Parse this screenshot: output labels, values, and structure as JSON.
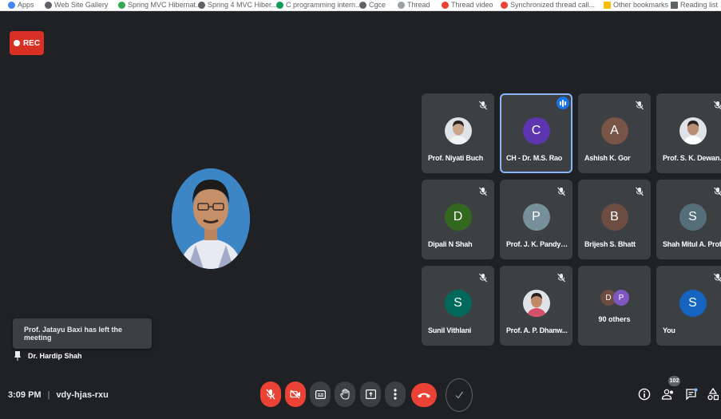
{
  "bookmarks": [
    {
      "label": "Apps",
      "color": "#4285f4"
    },
    {
      "label": "Web Site Gallery",
      "color": "#5f6368"
    },
    {
      "label": "Spring MVC Hibernat...",
      "color": "#34a853"
    },
    {
      "label": "Spring 4 MVC Hiber...",
      "color": "#5f6368"
    },
    {
      "label": "C programming intern...",
      "color": "#0f9d58"
    },
    {
      "label": "Cgce",
      "color": "#5f6368"
    },
    {
      "label": "Thread",
      "color": "#9aa0a6"
    },
    {
      "label": "Thread video",
      "color": "#ea4335"
    },
    {
      "label": "Synchronized thread call...",
      "color": "#ea4335"
    },
    {
      "label": "Other bookmarks",
      "color": "#fbbc04"
    },
    {
      "label": "Reading list",
      "color": "#5f6368"
    }
  ],
  "rec_label": "REC",
  "toast": "Prof. Jatayu Baxi has left the meeting",
  "pinned_name": "Dr. Hardip Shah",
  "meeting": {
    "time": "3:09 PM",
    "code": "vdy-hjas-rxu"
  },
  "participant_count": "102",
  "tiles": [
    {
      "name": "Prof. Niyati Buch",
      "initial": "",
      "color": "",
      "photo": true
    },
    {
      "name": "CH - Dr. M.S. Rao",
      "initial": "C",
      "color": "#5e35b1",
      "speaking": true
    },
    {
      "name": "Ashish K. Gor",
      "initial": "A",
      "color": "#795548"
    },
    {
      "name": "Prof. S. K. Dewan...",
      "initial": "",
      "color": "",
      "photo": true
    },
    {
      "name": "Dipali N Shah",
      "initial": "D",
      "color": "#33691e"
    },
    {
      "name": "Prof. J. K. Pandya...",
      "initial": "P",
      "color": "#78909c"
    },
    {
      "name": "Brijesh S. Bhatt",
      "initial": "B",
      "color": "#6d4c41"
    },
    {
      "name": "Shah Mitul A. Prof.",
      "initial": "S",
      "color": "#546e7a"
    },
    {
      "name": "Sunil Vithlani",
      "initial": "S",
      "color": "#00695c"
    },
    {
      "name": "Prof. A. P. Dhanw...",
      "initial": "",
      "color": "",
      "photo": true
    },
    {
      "name": "You",
      "initial": "S",
      "color": "#1565c0"
    }
  ],
  "others": {
    "label": "90 others",
    "initials": [
      "D",
      "P"
    ],
    "colors": [
      "#6d4c41",
      "#7e57c2"
    ]
  }
}
